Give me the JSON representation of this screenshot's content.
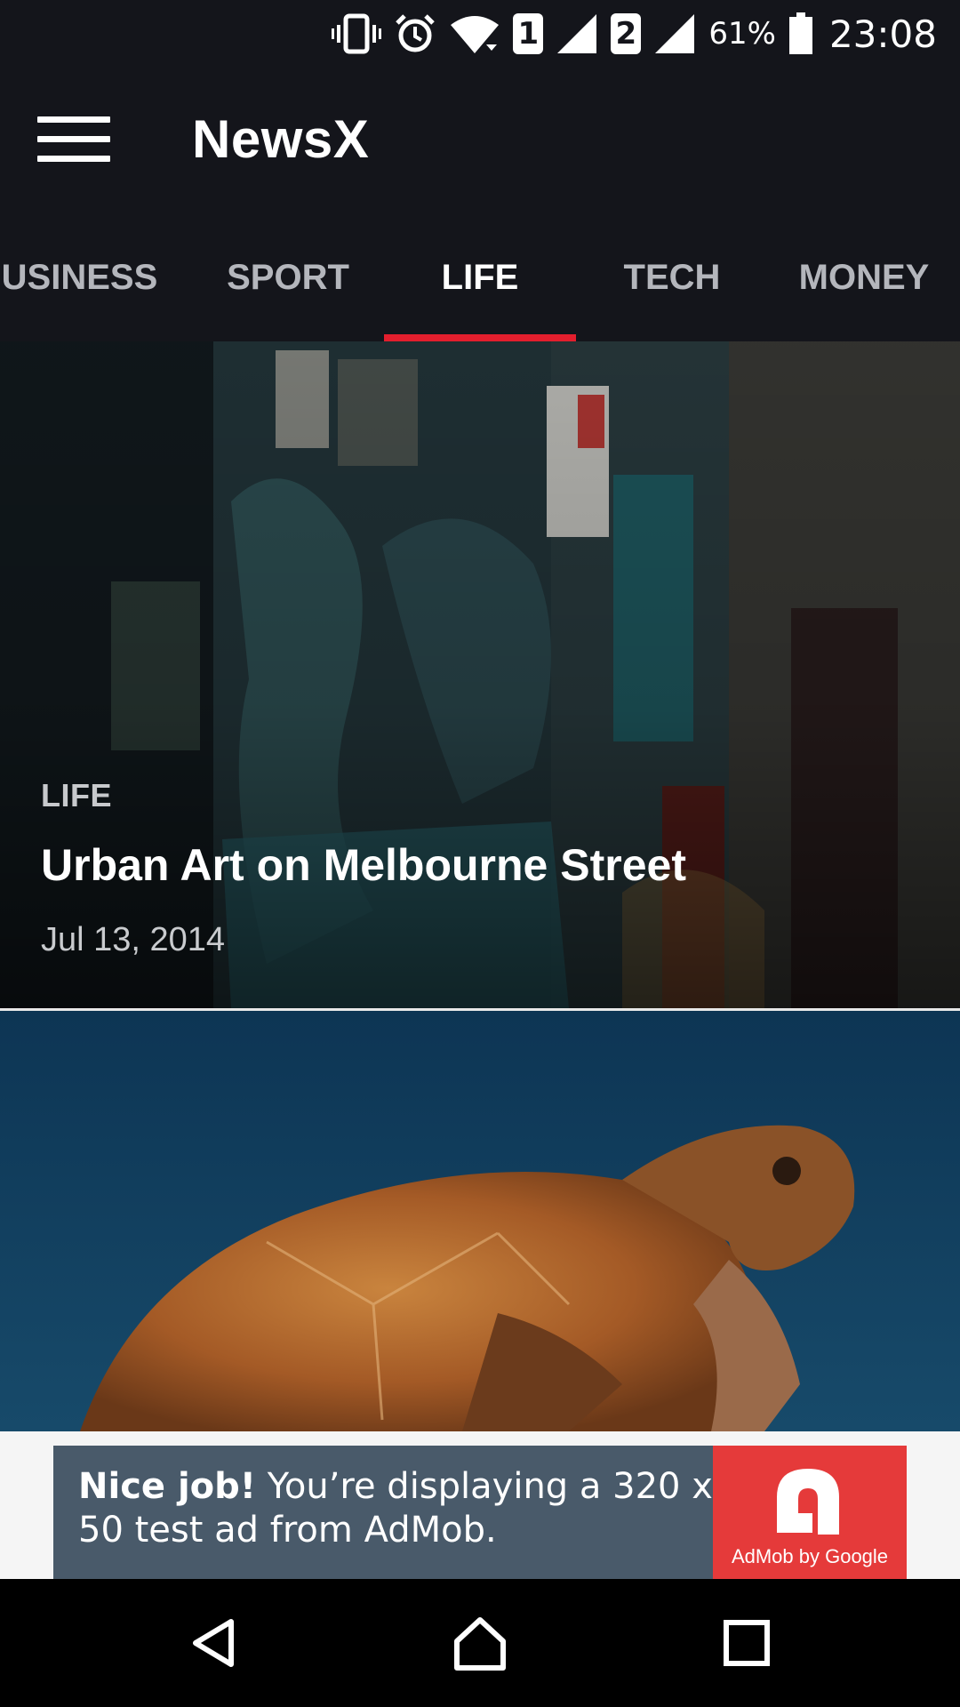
{
  "status_bar": {
    "icons": [
      "vibrate-icon",
      "alarm-icon",
      "wifi-icon",
      "sim1-icon",
      "signal-icon",
      "sim2-icon",
      "signal-icon",
      "battery-icon"
    ],
    "sim1": "1",
    "sim2": "2",
    "battery_percent": "61%",
    "time": "23:08"
  },
  "app_bar": {
    "title": "NewsX",
    "menu_icon": "hamburger-menu-icon"
  },
  "tabs": [
    {
      "label": "BUSINESS",
      "active": false
    },
    {
      "label": "SPORT",
      "active": false
    },
    {
      "label": "LIFE",
      "active": true
    },
    {
      "label": "TECH",
      "active": false
    },
    {
      "label": "MONEY",
      "active": false
    }
  ],
  "accent_color": "#e31e2d",
  "articles": [
    {
      "category": "LIFE",
      "title": "Urban Art on Melbourne Street",
      "date": "Jul 13, 2014"
    }
  ],
  "ad": {
    "headline": "Nice job!",
    "body": " You’re displaying a 320 x 50 test ad from AdMob.",
    "brand": "AdMob by Google"
  },
  "nav_bar": {
    "icons": [
      "back-icon",
      "home-icon",
      "recents-icon"
    ]
  }
}
